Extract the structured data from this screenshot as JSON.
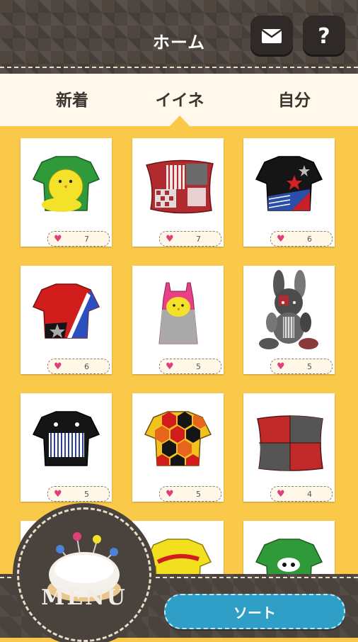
{
  "header": {
    "title": "ホーム",
    "mail_icon": "mail-icon",
    "help_label": "?"
  },
  "tabs": [
    {
      "label": "新着"
    },
    {
      "label": "イイネ"
    },
    {
      "label": "自分"
    }
  ],
  "items": [
    {
      "name": "yellow-chick-tshirt",
      "likes": "7"
    },
    {
      "name": "patchwork-pillow",
      "likes": "7"
    },
    {
      "name": "star-tshirt",
      "likes": "6"
    },
    {
      "name": "red-blue-tshirt",
      "likes": "6"
    },
    {
      "name": "chick-tank-dress",
      "likes": "5"
    },
    {
      "name": "patchwork-rabbit",
      "likes": "5"
    },
    {
      "name": "black-stripe-tshirt",
      "likes": "5"
    },
    {
      "name": "hexagon-tshirt",
      "likes": "5"
    },
    {
      "name": "red-gray-pillow",
      "likes": "4"
    }
  ],
  "bottom": {
    "menu_label": "MENU",
    "sort_label": "ソート"
  },
  "colors": {
    "background": "#fbc94a",
    "header": "#4f4640",
    "sort_button": "#2f9fc7",
    "heart": "#e0407a"
  }
}
